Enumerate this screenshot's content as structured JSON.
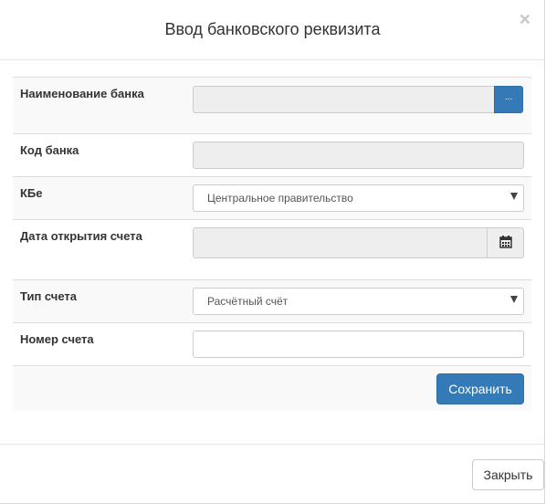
{
  "dialog": {
    "title": "Ввод банковского реквизита",
    "close_symbol": "×"
  },
  "form": {
    "bank_name": {
      "label": "Наименование банка",
      "value": "",
      "browse_label": "..."
    },
    "bank_code": {
      "label": "Код банка",
      "value": ""
    },
    "kbe": {
      "label": "КБе",
      "selected": "Центральное правительство"
    },
    "open_date": {
      "label": "Дата открытия счета",
      "value": "",
      "icon": "calendar-icon"
    },
    "account_type": {
      "label": "Тип счета",
      "selected": "Расчётный счёт"
    },
    "account_number": {
      "label": "Номер счета",
      "value": ""
    },
    "save_label": "Сохранить"
  },
  "footer": {
    "close_label": "Закрыть"
  },
  "colors": {
    "primary": "#337ab7",
    "disabled_bg": "#eeeeee",
    "row_alt_bg": "#f9f9f9"
  }
}
